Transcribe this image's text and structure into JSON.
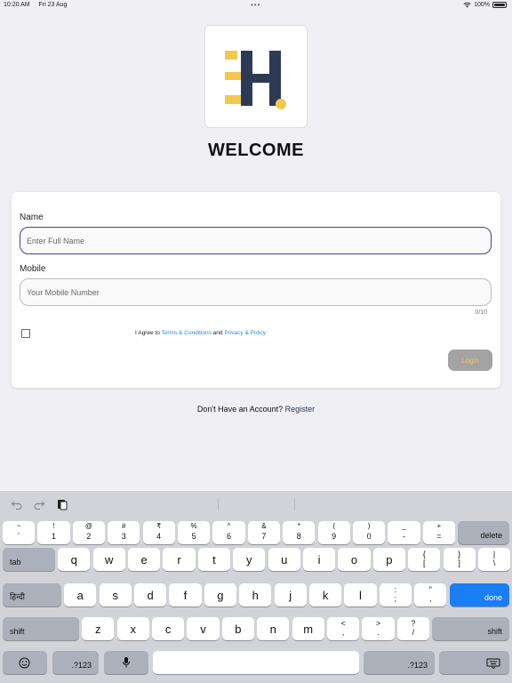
{
  "status": {
    "time": "10:20 AM",
    "date": "Fri 23 Aug",
    "battery": "100%"
  },
  "brand": {
    "logo_colors": {
      "yellow": "#f2c94c",
      "navy": "#2d3a55"
    }
  },
  "welcome": "WELCOME",
  "form": {
    "name_label": "Name",
    "name_placeholder": "Enter Full Name",
    "mobile_label": "Mobile",
    "mobile_placeholder": "Your Mobile Number",
    "mobile_counter": "0/10",
    "agree_prefix": "I Agree to ",
    "terms_link": "Terms & Conditions",
    "agree_and": " and ",
    "privacy_link": "Privacy & Policy",
    "login_label": "Login"
  },
  "register": {
    "prompt": "Don't Have an Account? ",
    "link": "Register"
  },
  "keyboard": {
    "row1": [
      {
        "t": "~",
        "b": "`"
      },
      {
        "t": "!",
        "b": "1"
      },
      {
        "t": "@",
        "b": "2"
      },
      {
        "t": "#",
        "b": "3"
      },
      {
        "t": "₹",
        "b": "4"
      },
      {
        "t": "%",
        "b": "5"
      },
      {
        "t": "^",
        "b": "6"
      },
      {
        "t": "&",
        "b": "7"
      },
      {
        "t": "*",
        "b": "8"
      },
      {
        "t": "(",
        "b": "9"
      },
      {
        "t": ")",
        "b": "0"
      },
      {
        "t": "_",
        "b": "-"
      },
      {
        "t": "+",
        "b": "="
      }
    ],
    "delete": "delete",
    "tab": "tab",
    "row2": [
      "q",
      "w",
      "e",
      "r",
      "t",
      "y",
      "u",
      "i",
      "o",
      "p"
    ],
    "row2_sym": [
      {
        "t": "{",
        "b": "["
      },
      {
        "t": "}",
        "b": "]"
      },
      {
        "t": "|",
        "b": "\\"
      }
    ],
    "lang": "हिन्दी",
    "row3": [
      "a",
      "s",
      "d",
      "f",
      "g",
      "h",
      "j",
      "k",
      "l"
    ],
    "row3_sym": [
      {
        "t": ":",
        "b": ";"
      },
      {
        "t": "\"",
        "b": ","
      }
    ],
    "done": "done",
    "shift": "shift",
    "row4": [
      "z",
      "x",
      "c",
      "v",
      "b",
      "n",
      "m"
    ],
    "row4_sym": [
      {
        "t": "<",
        "b": ","
      },
      {
        "t": ">",
        "b": "."
      },
      {
        "t": "?",
        "b": "/"
      }
    ],
    "numbers": ".?123"
  }
}
